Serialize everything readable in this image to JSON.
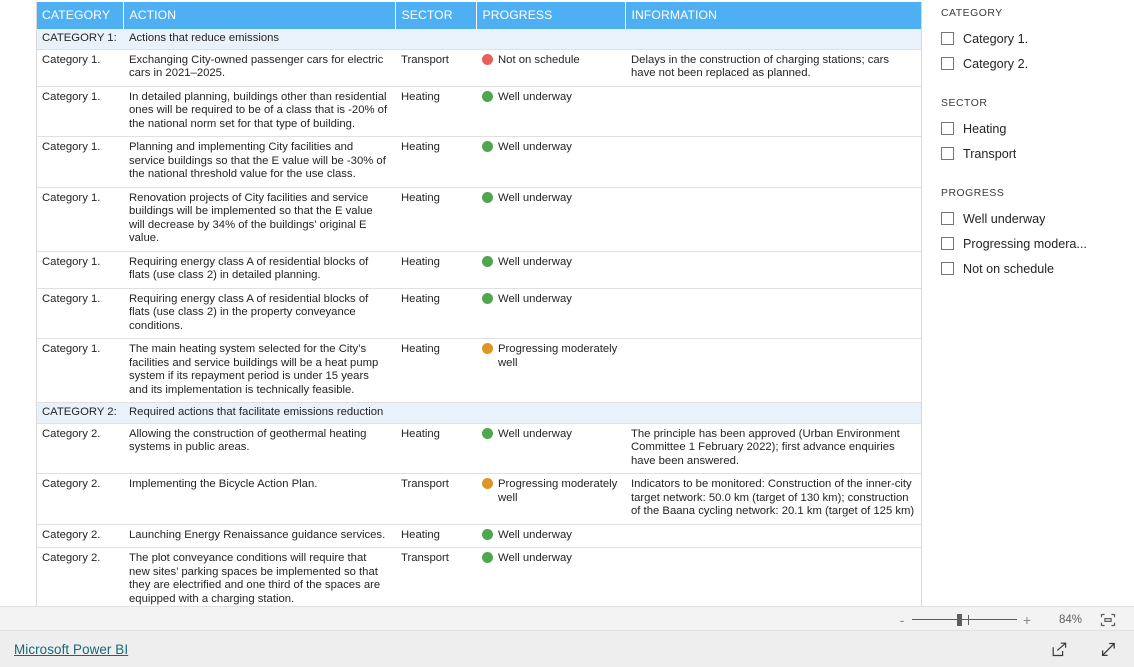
{
  "table": {
    "columns": [
      "CATEGORY",
      "ACTION",
      "SECTOR",
      "PROGRESS",
      "INFORMATION"
    ],
    "rows": [
      {
        "kind": "category",
        "category": "CATEGORY 1:",
        "action": "Actions that reduce emissions",
        "sector": "",
        "progress": "",
        "progress_status": "",
        "information": ""
      },
      {
        "kind": "data",
        "category": "Category 1.",
        "action": "Exchanging City-owned passenger cars for electric cars in 2021–2025.",
        "sector": "Transport",
        "progress": "Not on schedule",
        "progress_status": "not-on-schedule",
        "information": "Delays in the construction of charging stations; cars have not been replaced as planned."
      },
      {
        "kind": "data",
        "category": "Category 1.",
        "action": "In detailed planning, buildings other than residential ones will be required to be of a class that is -20% of the national norm set for that type of building.",
        "sector": "Heating",
        "progress": "Well underway",
        "progress_status": "well-underway",
        "information": ""
      },
      {
        "kind": "data",
        "category": "Category 1.",
        "action": "Planning and implementing City facilities and service buildings so that the E value will be -30% of the national threshold value for the use class.",
        "sector": "Heating",
        "progress": "Well underway",
        "progress_status": "well-underway",
        "information": ""
      },
      {
        "kind": "data",
        "category": "Category 1.",
        "action": "Renovation projects of City facilities and service buildings will be implemented so that the E value will decrease by 34% of the buildings’ original E value.",
        "sector": "Heating",
        "progress": "Well underway",
        "progress_status": "well-underway",
        "information": ""
      },
      {
        "kind": "data",
        "category": "Category 1.",
        "action": "Requiring energy class A of residential blocks of flats (use class 2) in detailed planning.",
        "sector": "Heating",
        "progress": "Well underway",
        "progress_status": "well-underway",
        "information": ""
      },
      {
        "kind": "data",
        "category": "Category 1.",
        "action": "Requiring energy class A of residential blocks of flats (use class 2) in the property conveyance conditions.",
        "sector": "Heating",
        "progress": "Well underway",
        "progress_status": "well-underway",
        "information": ""
      },
      {
        "kind": "data",
        "category": "Category 1.",
        "action": "The main heating system selected for the City’s facilities and service buildings will be a heat pump system if its repayment period is under 15 years and its implementation is technically feasible.",
        "sector": "Heating",
        "progress": "Progressing moderately well",
        "progress_status": "progressing-moderately-well",
        "information": ""
      },
      {
        "kind": "category",
        "category": "CATEGORY 2:",
        "action": "Required actions that facilitate emissions reduction",
        "sector": "",
        "progress": "",
        "progress_status": "",
        "information": ""
      },
      {
        "kind": "data",
        "category": "Category 2.",
        "action": "Allowing the construction of geothermal heating systems in public areas.",
        "sector": "Heating",
        "progress": "Well underway",
        "progress_status": "well-underway",
        "information": "The principle has been approved (Urban Environment Committee 1 February 2022); first advance enquiries have been answered."
      },
      {
        "kind": "data",
        "category": "Category 2.",
        "action": "Implementing the Bicycle Action Plan.",
        "sector": "Transport",
        "progress": "Progressing moderately well",
        "progress_status": "progressing-moderately-well",
        "information": "Indicators to be monitored: Construction of the inner-city target network: 50.0 km (target of 130 km); construction of the Baana cycling network: 20.1 km (target of 125 km)"
      },
      {
        "kind": "data",
        "category": "Category 2.",
        "action": "Launching Energy Renaissance guidance services.",
        "sector": "Heating",
        "progress": "Well underway",
        "progress_status": "well-underway",
        "information": ""
      },
      {
        "kind": "data",
        "category": "Category 2.",
        "action": "The plot conveyance conditions will require that new sites’ parking spaces be implemented so that they are electrified and one third of the spaces are equipped with a charging station.",
        "sector": "Transport",
        "progress": "Well underway",
        "progress_status": "well-underway",
        "information": ""
      }
    ]
  },
  "status_colors": {
    "well-underway": "#4fa64f",
    "progressing-moderately-well": "#dd9526",
    "not-on-schedule": "#e8605c"
  },
  "theme": {
    "header_blue": "#4eb0f2",
    "category_row_bg": "#e9f2fb",
    "link_teal": "#16697a"
  },
  "filters": {
    "groups": [
      {
        "title": "CATEGORY",
        "items": [
          {
            "label": "Category 1.",
            "checked": false
          },
          {
            "label": "Category 2.",
            "checked": false
          }
        ]
      },
      {
        "title": "SECTOR",
        "items": [
          {
            "label": "Heating",
            "checked": false
          },
          {
            "label": "Transport",
            "checked": false
          }
        ]
      },
      {
        "title": "PROGRESS",
        "items": [
          {
            "label": "Well underway",
            "checked": false
          },
          {
            "label": "Progressing modera...",
            "checked": false
          },
          {
            "label": "Not on schedule",
            "checked": false
          }
        ]
      }
    ]
  },
  "statusbar": {
    "zoom_out_label": "-",
    "zoom_in_label": "+",
    "zoom_percent": "84%",
    "fit_icon": "fit-to-screen-icon"
  },
  "footer": {
    "brand": "Microsoft Power BI",
    "share_icon": "share-export-icon",
    "fullscreen_icon": "fullscreen-expand-icon"
  }
}
